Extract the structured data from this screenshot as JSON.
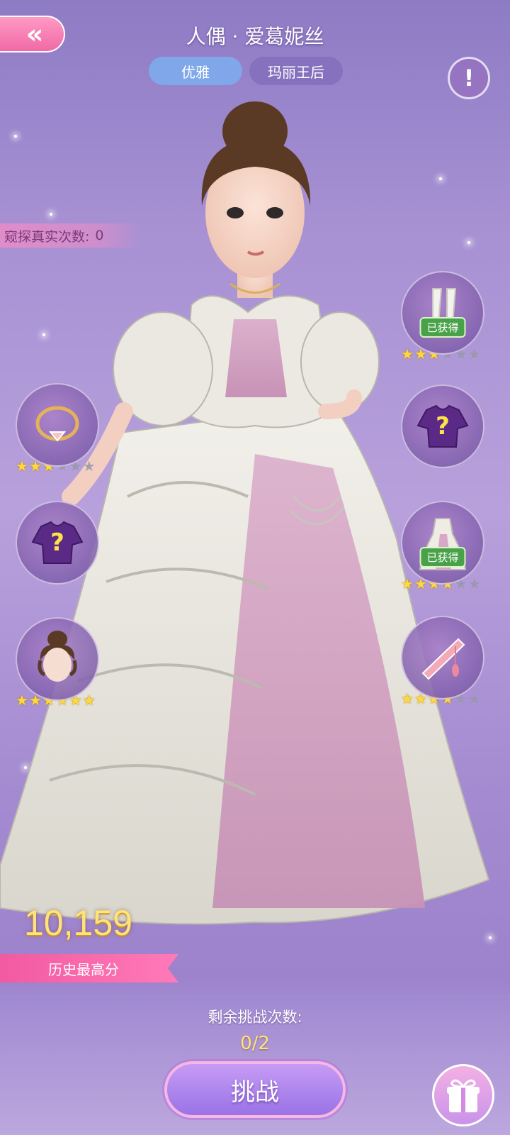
{
  "header": {
    "back_icon": "double-chevron-left-icon",
    "title": "人偶 · 爱葛妮丝",
    "tabs": [
      {
        "label": "优雅",
        "active": true
      },
      {
        "label": "玛丽王后",
        "active": false
      }
    ],
    "info_icon": "exclamation-icon",
    "info_label": "!"
  },
  "peek": {
    "label": "窥探真实次数:",
    "count": "0"
  },
  "items": {
    "bracelet": {
      "icon": "bracelet-icon",
      "stars": 3,
      "max_stars": 6
    },
    "mystery_left": {
      "icon": "mystery-top-icon",
      "qmark": "?"
    },
    "hair": {
      "icon": "hairstyle-icon",
      "stars": 6,
      "max_stars": 6
    },
    "stockings": {
      "icon": "stockings-icon",
      "badge": "已获得",
      "stars": 3,
      "max_stars": 6
    },
    "mystery_right": {
      "icon": "mystery-top-icon",
      "qmark": "?"
    },
    "dress": {
      "icon": "dress-icon",
      "badge": "已获得",
      "stars": 4,
      "max_stars": 6
    },
    "fan": {
      "icon": "folding-fan-icon",
      "stars": 4,
      "max_stars": 6
    }
  },
  "score": {
    "value": "10,159",
    "label": "历史最高分"
  },
  "challenge": {
    "remain_label": "剩余挑战次数:",
    "remain_count": "0/2",
    "button_label": "挑战"
  },
  "gift_icon": "gift-icon",
  "colors": {
    "accent_pink": "#f25aa1",
    "gold": "#ffe37a",
    "tab_blue": "#7fa7ea",
    "obtained_green": "#49a24a"
  }
}
